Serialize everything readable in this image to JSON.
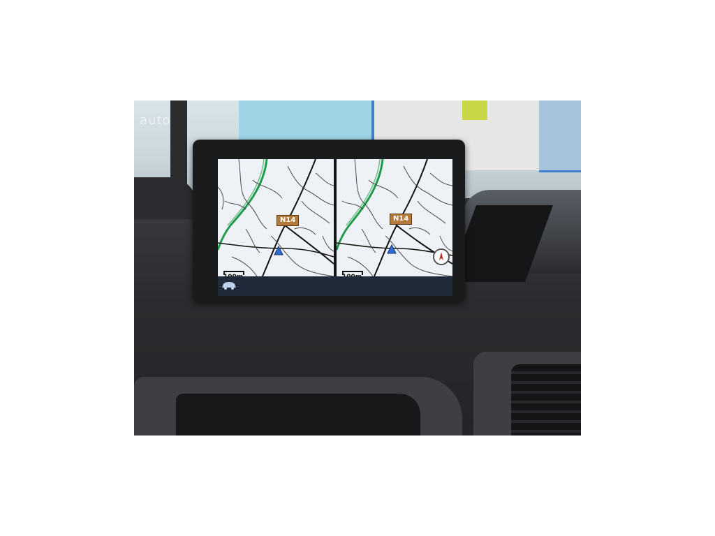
{
  "photo": {
    "watermark": "auto"
  },
  "navigation_display": {
    "left_map": {
      "road_label": "N14",
      "scale_label": "100m",
      "position_marker": "blue-triangle-icon"
    },
    "right_map": {
      "road_label": "N14",
      "scale_label": "100m",
      "position_marker": "blue-triangle-icon",
      "compass": "north-compass-icon"
    },
    "status_bar": {
      "icon": "car-icon"
    },
    "colors": {
      "motorway": "#1f9a4a",
      "main_road": "#111111",
      "minor_road": "#4a4a4a",
      "map_background": "#eef1f5",
      "road_label_bg": "#b47a3c",
      "vehicle_marker": "#2f6fd6",
      "status_bar": "#1e2a38"
    }
  }
}
